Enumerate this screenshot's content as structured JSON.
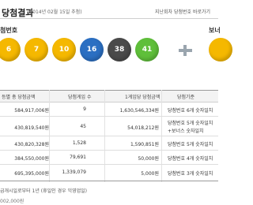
{
  "header": {
    "title": "당첨결과",
    "date": "(2014년 02월 15일 추첨)",
    "prev_link": "지난회차 당첨번호 바로가기"
  },
  "sections": {
    "winning_numbers": "첨번호",
    "bonus": "보너"
  },
  "balls": [
    {
      "value": "6",
      "color": "#f5b800"
    },
    {
      "value": "7",
      "color": "#f5b800"
    },
    {
      "value": "10",
      "color": "#f5b800"
    },
    {
      "value": "16",
      "color": "#2b6fc2"
    },
    {
      "value": "38",
      "color": "#4a4a4a"
    },
    {
      "value": "41",
      "color": "#5fbf3a"
    }
  ],
  "bonus_ball": {
    "value": "",
    "color": "#f5b800"
  },
  "table": {
    "headers": [
      "등별 총 당첨금액",
      "당첨게임 수",
      "1게임당 당첨금액",
      "당첨기준"
    ],
    "rows": [
      {
        "total": "584,917,006원",
        "count": "9",
        "per_game": "1,630,546,334원",
        "criteria": "당첨번호 6개 숫자일치"
      },
      {
        "total": "430,819,540원",
        "count": "45",
        "per_game": "54,018,212원",
        "criteria": "당첨번호 5개 숫자일치",
        "criteria2": "+보너스 숫자일치"
      },
      {
        "total": "430,820,328원",
        "count": "1,528",
        "per_game": "1,590,851원",
        "criteria": "당첨번호 5개 숫자일치"
      },
      {
        "total": "384,550,000원",
        "count": "79,691",
        "per_game": "50,000원",
        "criteria": "당첨번호 4개 숫자일치"
      },
      {
        "total": "695,395,000원",
        "count": "1,339,079",
        "per_game": "5,000원",
        "criteria": "당첨번호 3개 숫자일치"
      }
    ]
  },
  "footer": {
    "note": "급개시일로부터 1년 (휴일인 경우 익영업일)",
    "note2": "002,000원"
  }
}
